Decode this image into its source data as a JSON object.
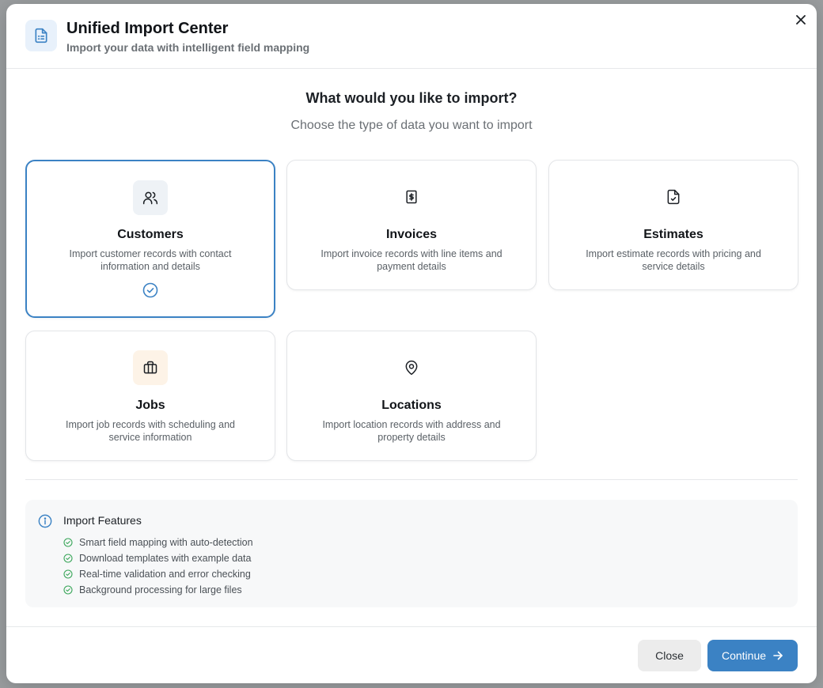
{
  "header": {
    "title": "Unified Import Center",
    "subtitle": "Import your data with intelligent field mapping",
    "icon": "document-icon",
    "close_icon": "close-icon"
  },
  "main": {
    "question": "What would you like to import?",
    "question_sub": "Choose the type of data you want to import"
  },
  "cards": [
    {
      "id": "customers",
      "title": "Customers",
      "description": "Import customer records with contact information and details",
      "icon": "users-icon",
      "selected": true
    },
    {
      "id": "invoices",
      "title": "Invoices",
      "description": "Import invoice records with line items and payment details",
      "icon": "invoice-dollar-icon",
      "selected": false
    },
    {
      "id": "estimates",
      "title": "Estimates",
      "description": "Import estimate records with pricing and service details",
      "icon": "document-check-icon",
      "selected": false
    },
    {
      "id": "jobs",
      "title": "Jobs",
      "description": "Import job records with scheduling and service information",
      "icon": "briefcase-icon",
      "selected": false
    },
    {
      "id": "locations",
      "title": "Locations",
      "description": "Import location records with address and property details",
      "icon": "map-pin-icon",
      "selected": false
    }
  ],
  "features": {
    "title": "Import Features",
    "icon": "info-icon",
    "items": [
      "Smart field mapping with auto-detection",
      "Download templates with example data",
      "Real-time validation and error checking",
      "Background processing for large files"
    ]
  },
  "footer": {
    "close_label": "Close",
    "continue_label": "Continue"
  },
  "colors": {
    "accent": "#3b82c4",
    "success": "#3aa65a",
    "jobs_icon_bg": "#fdf3e7",
    "customers_icon_bg": "#eef2f6"
  }
}
